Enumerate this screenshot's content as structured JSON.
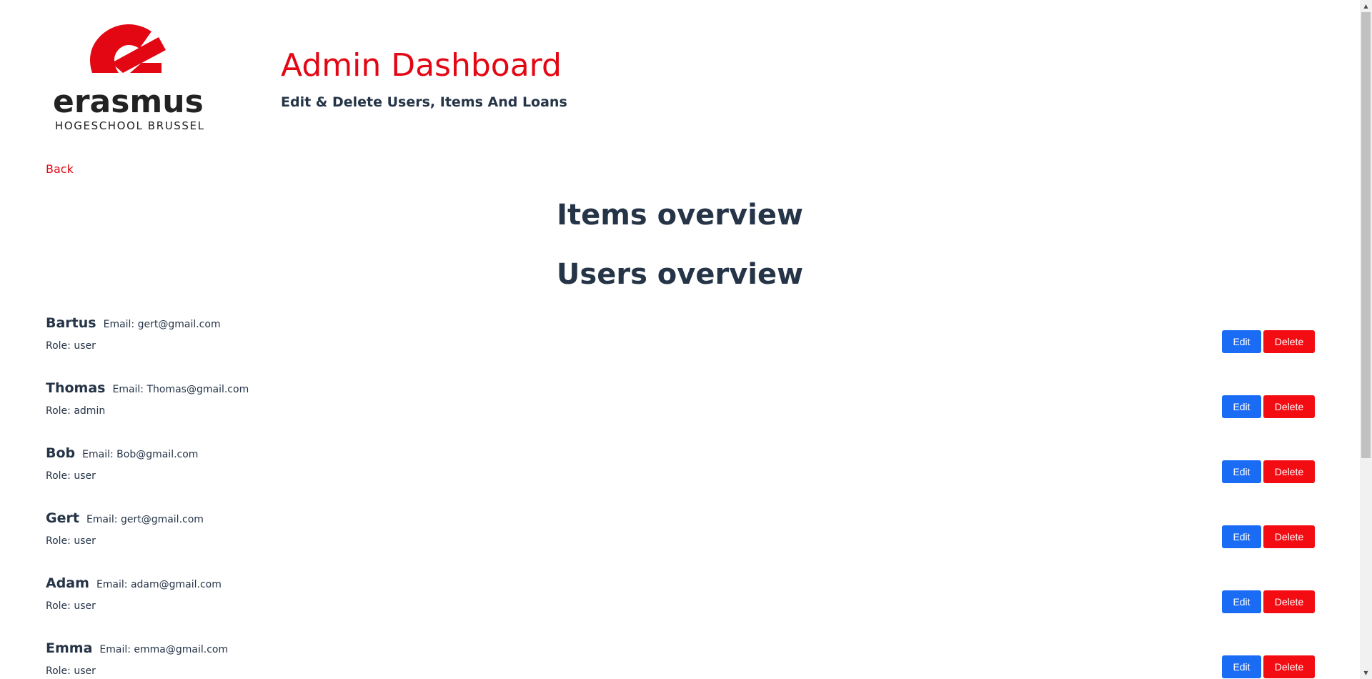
{
  "header": {
    "logo": {
      "word": "erasmus",
      "sub": "HOGESCHOOL BRUSSEL"
    },
    "title": "Admin Dashboard",
    "subtitle": "Edit & Delete Users, Items And Loans"
  },
  "nav": {
    "back_label": "Back"
  },
  "sections": {
    "items_title": "Items overview",
    "users_title": "Users overview"
  },
  "users": [
    {
      "name": "Bartus",
      "email": "Email: gert@gmail.com",
      "role": "Role: user",
      "edit_label": "Edit",
      "delete_label": "Delete"
    },
    {
      "name": "Thomas",
      "email": "Email: Thomas@gmail.com",
      "role": "Role: admin",
      "edit_label": "Edit",
      "delete_label": "Delete"
    },
    {
      "name": "Bob",
      "email": "Email: Bob@gmail.com",
      "role": "Role: user",
      "edit_label": "Edit",
      "delete_label": "Delete"
    },
    {
      "name": "Gert",
      "email": "Email: gert@gmail.com",
      "role": "Role: user",
      "edit_label": "Edit",
      "delete_label": "Delete"
    },
    {
      "name": "Adam",
      "email": "Email: adam@gmail.com",
      "role": "Role: user",
      "edit_label": "Edit",
      "delete_label": "Delete"
    },
    {
      "name": "Emma",
      "email": "Email: emma@gmail.com",
      "role": "Role: user",
      "edit_label": "Edit",
      "delete_label": "Delete"
    }
  ],
  "colors": {
    "brand_red": "#e30613",
    "text_dark": "#253447",
    "edit_blue": "#1a6cf5",
    "delete_red": "#f40c13"
  },
  "icons": {
    "scroll_up": "▲",
    "scroll_down": "▼"
  }
}
